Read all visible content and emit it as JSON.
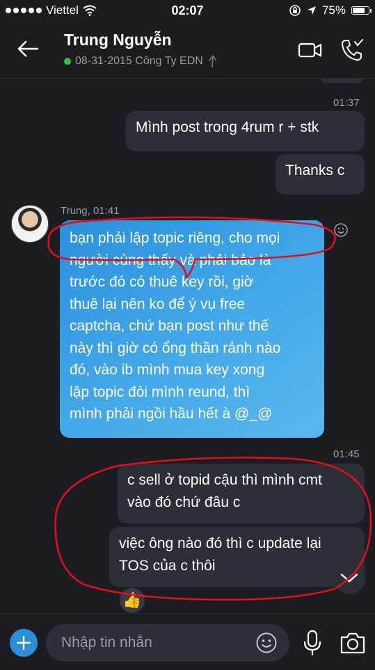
{
  "status_bar": {
    "carrier": "Viettel",
    "time": "02:07",
    "battery_text": "75%",
    "battery_level": 0.75
  },
  "header": {
    "contact_name": "Trung Nguyễn",
    "contact_status": "08-31-2015 Công Ty EDN"
  },
  "messages": {
    "time_1": "01:37",
    "out_1": "Mình post trong 4rum r + stk",
    "out_2": "Thanks c",
    "sender_line": "Trung, 01:41",
    "in_lines": [
      "bạn phải lập topic riêng, cho mọi",
      "người cùng thấy và phải bảo là",
      "trước đó có thuê key rồi, giờ",
      "thuê lại nên ko để ý vụ free",
      "captcha, chứ bạn post như thế",
      "này thì giờ có ổng thần rảnh nào",
      "đó, vào ib mình mua key xong",
      "lập topic đòi mình reund, thì",
      "mình phải ngồi hầu hết à @_@"
    ],
    "time_2": "01:45",
    "out_3_lines": [
      "c sell ở topid cậu thì mình cmt",
      "vào đó chứ đâu c"
    ],
    "out_4_lines": [
      "việc ông nào đó thì c update lại",
      "TOS của c thôi"
    ]
  },
  "input": {
    "placeholder": "Nhập tin nhắn"
  },
  "icons": {
    "back": "back-arrow-icon",
    "video": "video-call-icon",
    "call": "phone-call-icon",
    "add": "plus-icon",
    "emoji": "emoji-icon",
    "mic": "microphone-icon",
    "camera": "camera-icon",
    "scroll": "chevron-down-icon",
    "reaction": "thumbs-up-icon"
  },
  "colors": {
    "background": "#1c1d22",
    "bubble_out": "#2d2f37",
    "bubble_in": "#3a9fe3",
    "accent": "#2c8ed9",
    "online": "#37c24a",
    "annotation": "#e0101a"
  }
}
